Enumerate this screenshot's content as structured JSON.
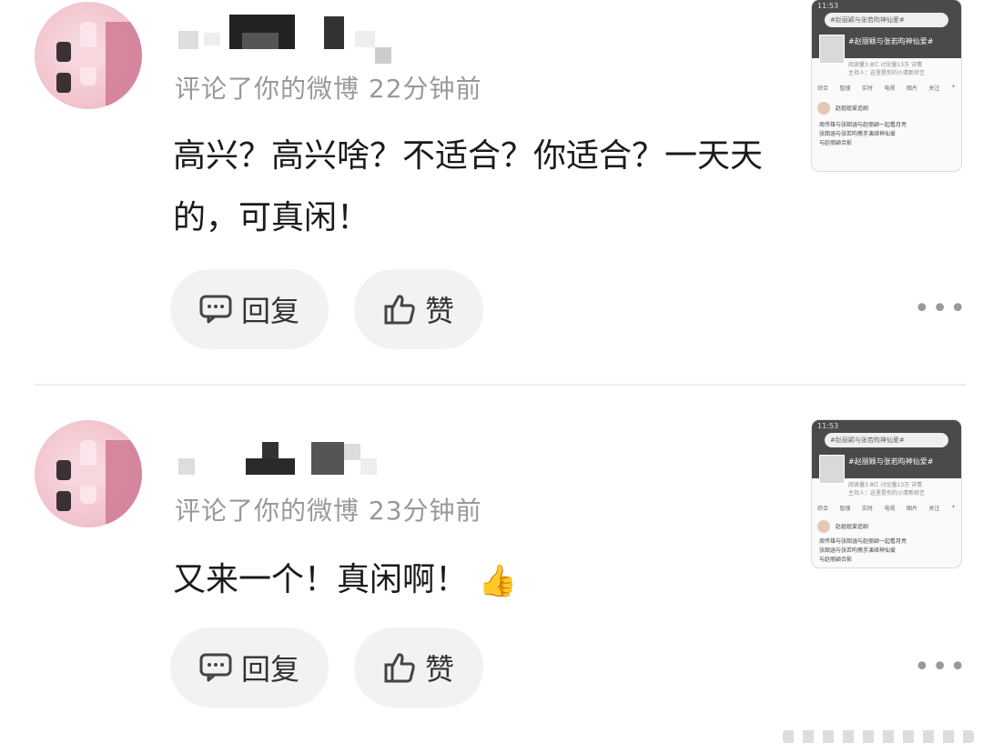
{
  "comments": [
    {
      "meta": "评论了你的微博 22分钟前",
      "text": "高兴？高兴啥？不适合？你适合？一天天的，可真闲！",
      "emoji": "",
      "reply_label": "回复",
      "like_label": "赞"
    },
    {
      "meta": "评论了你的微博 23分钟前",
      "text": "又来一个！真闲啊！",
      "emoji": "👍",
      "reply_label": "回复",
      "like_label": "赞"
    }
  ],
  "thumbnail": {
    "status_time": "11:53",
    "search_text": "#赵丽颖与张若昀神仙爱#",
    "topic": "#赵丽颖与张若昀神仙爱#",
    "info_line1": "阅读量3.8亿  讨论量13万 详情",
    "info_line2": "主持人：这里是你的小清新综艺",
    "tabs": [
      "综合",
      "智搜",
      "实时",
      "电视",
      "图片",
      "关注",
      "+"
    ],
    "user_name": "赵姐姐爱追剧",
    "post_line1": "周传雄与张韶涵与赵丽颖一起看月亮",
    "post_line2": "张韶涵与张若昀携手演绎神仙爱",
    "post_line3": "与赵丽颖合影"
  },
  "icons": {
    "reply": "comment-icon",
    "like": "thumbs-up-icon",
    "more": "more-icon"
  }
}
